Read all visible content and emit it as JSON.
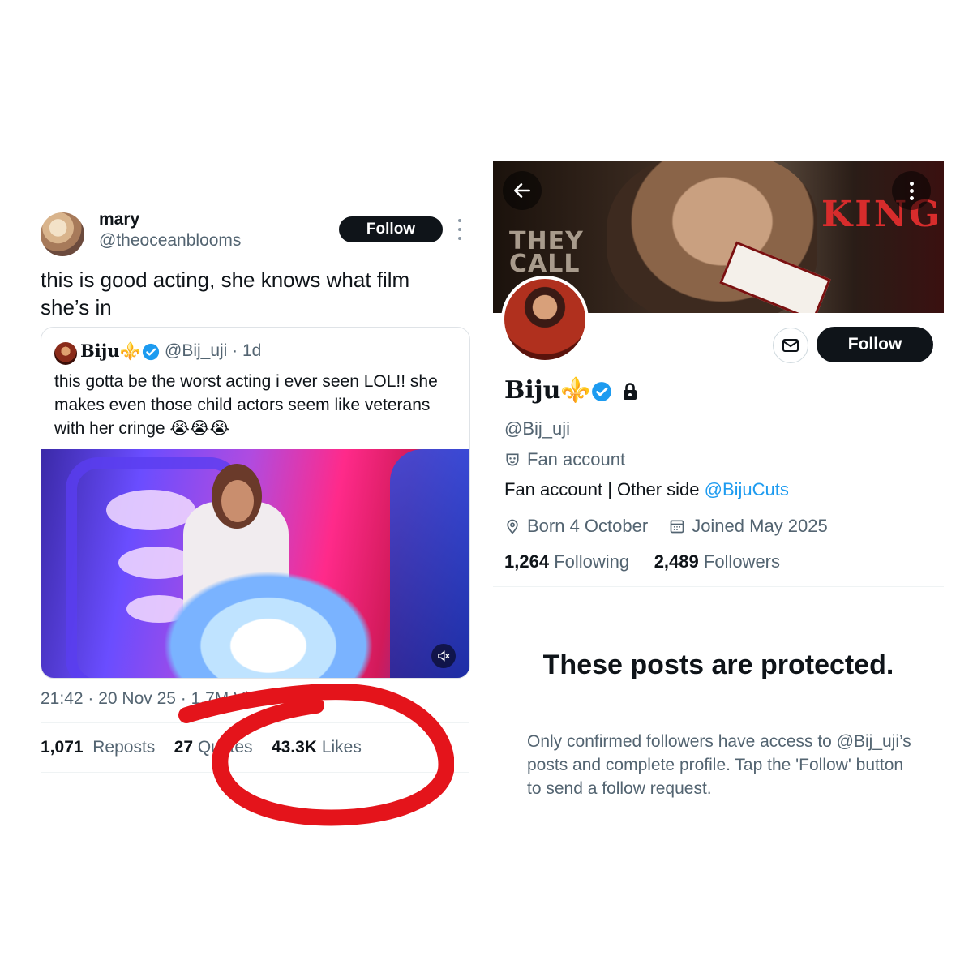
{
  "tweet": {
    "author_name": "mary",
    "author_handle": "@theoceanblooms",
    "follow_label": "Follow",
    "text": "this is good acting, she knows what film she’s in",
    "quote": {
      "author_name": "Biju⚜️",
      "handle_time": "@Bij_uji · 1d",
      "text": "this gotta be the worst acting i ever seen LOL!! she makes even those child actors seem like veterans with her cringe 😭😭😭"
    },
    "meta": "21:42 · 20 Nov 25 · 1.7M Views",
    "stats": {
      "reposts_count": "1,071",
      "reposts_label": "Repost s",
      "quotes_count": "27",
      "quotes_label": "Quotes",
      "likes_count": "43.3K",
      "likes_label": "Likes"
    }
  },
  "profile": {
    "banner_text_1": "THEY",
    "banner_text_2": "CALL",
    "banner_king": "KING",
    "follow_label": "Follow",
    "name": "Biju⚜️",
    "handle": "@Bij_uji",
    "category": "Fan account",
    "bio_prefix": "Fan account | Other side ",
    "bio_link": "@BijuCuts",
    "born": "Born 4 October",
    "joined": "Joined May 2025",
    "following_count": "1,264",
    "following_label": "Following",
    "followers_count": "2,489",
    "followers_label": "Followers",
    "protected_title": "These posts are protected.",
    "protected_text": "Only confirmed followers have access to @Bij_uji’s posts and complete profile. Tap the 'Follow' button to send a follow request."
  },
  "colors": {
    "accent": "#1d9bf0",
    "annotation": "#e4141b",
    "king_red": "#d72c2c"
  }
}
